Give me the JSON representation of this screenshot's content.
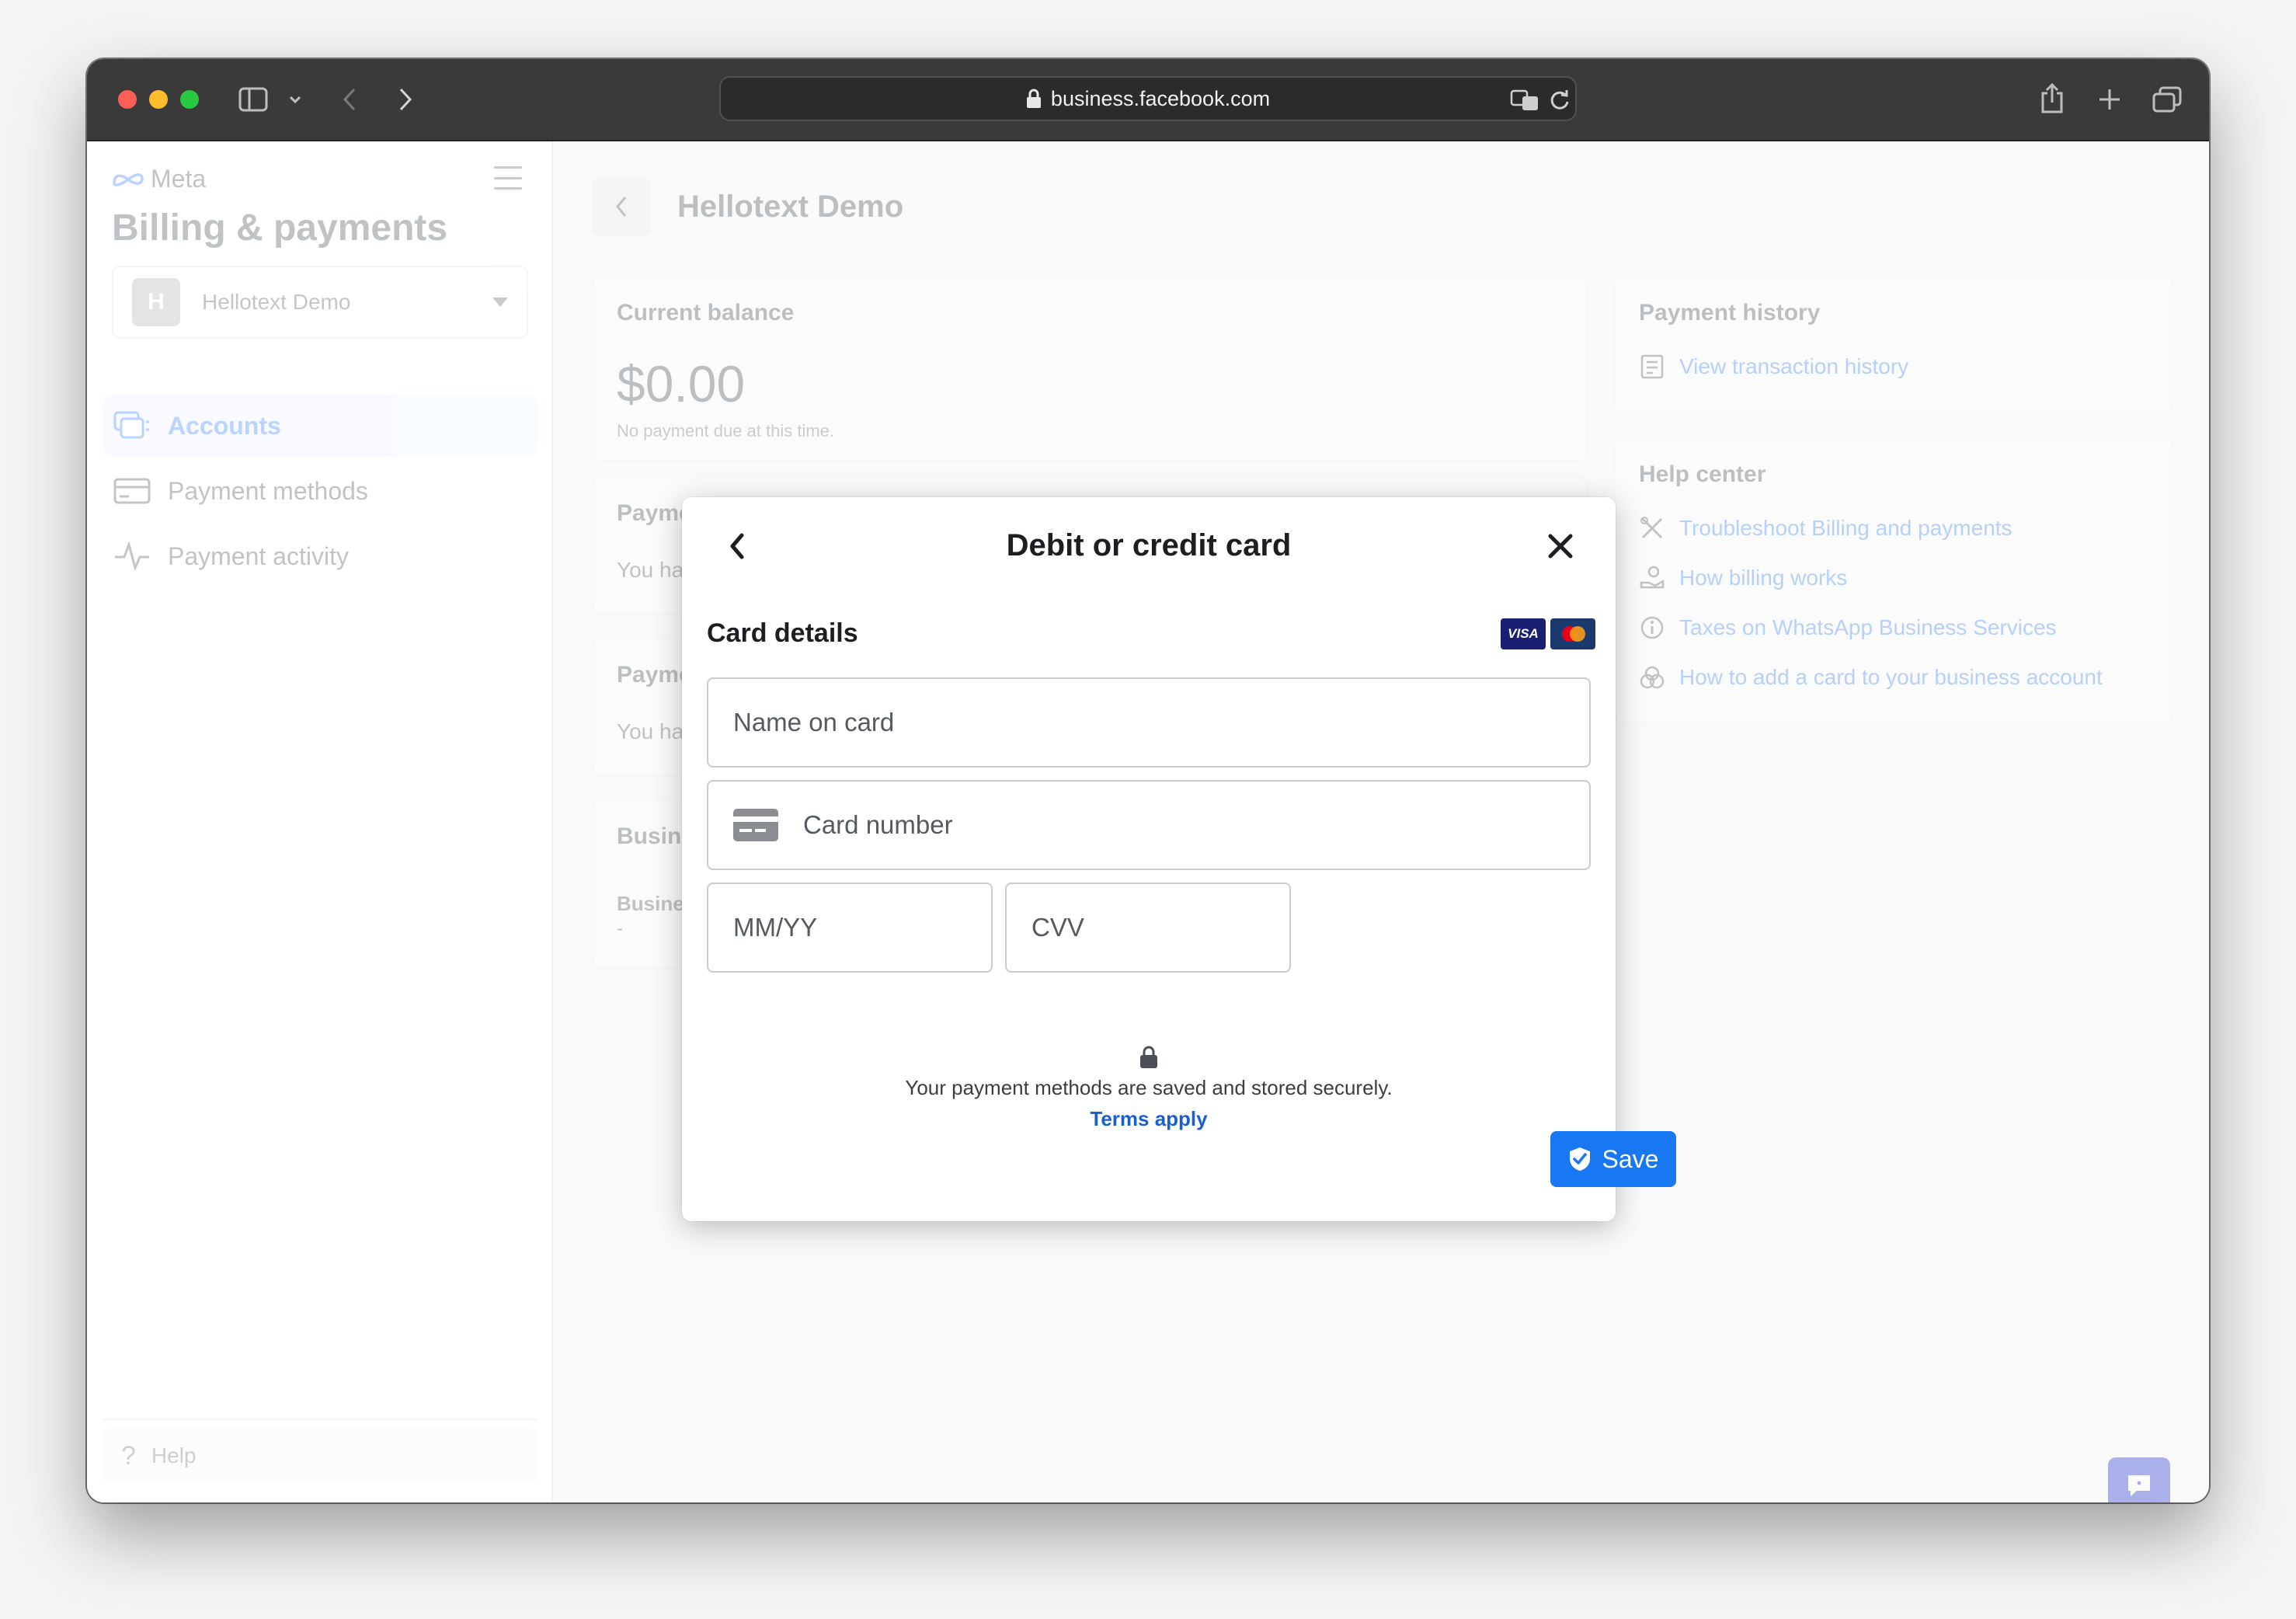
{
  "browser": {
    "url": "business.facebook.com"
  },
  "sidebar": {
    "brand": "Meta",
    "title": "Billing & payments",
    "account": {
      "initial": "H",
      "name": "Hellotext Demo"
    },
    "items": [
      {
        "label": "Accounts",
        "icon": "accounts-icon",
        "active": true
      },
      {
        "label": "Payment methods",
        "icon": "credit-card-icon",
        "active": false
      },
      {
        "label": "Payment activity",
        "icon": "activity-icon",
        "active": false
      }
    ],
    "help_label": "Help"
  },
  "main": {
    "title": "Hellotext Demo",
    "balance": {
      "heading": "Current balance",
      "amount": "$0.00",
      "note": "No payment due at this time."
    },
    "partial_cards": [
      {
        "heading": "Payme",
        "body": "You ha"
      },
      {
        "heading": "Payme",
        "body": "You ha"
      },
      {
        "heading": "Busine",
        "body": "Busine",
        "extra": "-"
      }
    ],
    "payment_history": {
      "heading": "Payment history",
      "link": "View transaction history"
    },
    "help_center": {
      "heading": "Help center",
      "links": [
        "Troubleshoot Billing and payments",
        "How billing works",
        "Taxes on WhatsApp Business Services",
        "How to add a card to your business account"
      ]
    }
  },
  "modal": {
    "title": "Debit or credit card",
    "section": "Card details",
    "brands": [
      "VISA",
      "Mastercard"
    ],
    "fields": {
      "name_placeholder": "Name on card",
      "number_placeholder": "Card number",
      "expiry_placeholder": "MM/YY",
      "cvv_placeholder": "CVV"
    },
    "secure_text": "Your payment methods are saved and stored securely.",
    "terms_link": "Terms apply",
    "save_label": "Save"
  },
  "colors": {
    "primary": "#1877f2",
    "link": "#1b5fcf",
    "titlebar": "#3a3a3a"
  }
}
